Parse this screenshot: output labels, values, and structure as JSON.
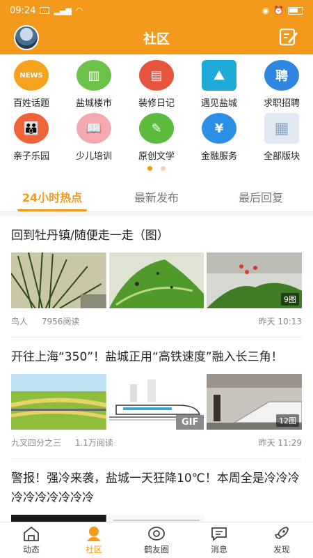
{
  "status": {
    "time": "09:24"
  },
  "header": {
    "title": "社区"
  },
  "categories": [
    {
      "label": "百姓话题",
      "icon": "news-icon",
      "glyph": "NEWS",
      "color": "#f6a21c"
    },
    {
      "label": "盐城楼市",
      "icon": "building-icon",
      "glyph": "▥",
      "color": "#6cc14a"
    },
    {
      "label": "装修日记",
      "icon": "notebook-icon",
      "glyph": "▤",
      "color": "#e7543e"
    },
    {
      "label": "遇见盐城",
      "icon": "landscape-icon",
      "glyph": "⛰",
      "color": "#1fa9d9"
    },
    {
      "label": "求职招聘",
      "icon": "recruit-icon",
      "glyph": "聘",
      "color": "#2f86e0"
    },
    {
      "label": "亲子乐园",
      "icon": "family-icon",
      "glyph": "👪",
      "color": "#f0623a"
    },
    {
      "label": "少儿培训",
      "icon": "reading-icon",
      "glyph": "📖",
      "color": "#f4a8b0"
    },
    {
      "label": "原创文学",
      "icon": "reader-icon",
      "glyph": "✎",
      "color": "#5cba3c"
    },
    {
      "label": "金融服务",
      "icon": "money-bag-icon",
      "glyph": "¥",
      "color": "#2c8fe6"
    },
    {
      "label": "全部版块",
      "icon": "grid-icon",
      "glyph": "▦",
      "color": "#dfe8f3"
    }
  ],
  "tabs": [
    "24小时热点",
    "最新发布",
    "最后回复"
  ],
  "posts": [
    {
      "title": "回到牡丹镇/随便走一走（图）",
      "author": "鸟人",
      "reads": "7956阅读",
      "time": "昨天 10:13",
      "image_count": "9图"
    },
    {
      "title": "开往上海“350”！盐城正用“高铁速度”融入长三角！",
      "author": "九叉四分之三",
      "reads": "1.1万阅读",
      "time": "昨天 11:29",
      "image_count": "12图",
      "gif": "GIF"
    },
    {
      "title": "警报！强冷来袭，盐城一天狂降10℃！本周全是冷冷冷冷冷冷冷冷冷冷"
    }
  ],
  "bottom_nav": [
    {
      "label": "动态",
      "icon": "home-icon"
    },
    {
      "label": "社区",
      "icon": "community-icon"
    },
    {
      "label": "鹤友圈",
      "icon": "camera-icon"
    },
    {
      "label": "消息",
      "icon": "message-icon"
    },
    {
      "label": "发现",
      "icon": "rocket-icon"
    }
  ],
  "colors": {
    "brand": "#f39a1d"
  }
}
